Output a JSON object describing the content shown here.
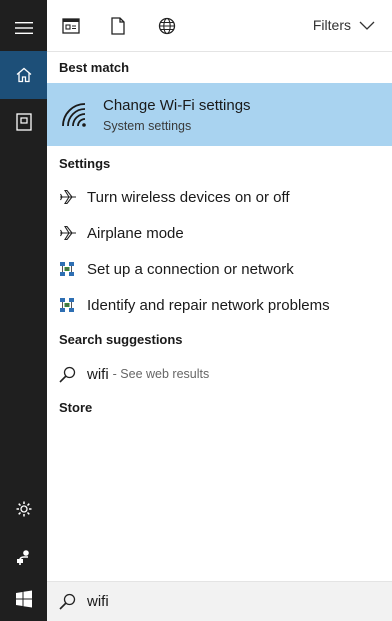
{
  "rail": {
    "menu_icon": "hamburger-menu-icon",
    "home_icon": "home-icon",
    "notebook_icon": "notebook-icon",
    "settings_icon": "gear-icon",
    "feedback_icon": "feedback-icon",
    "start_icon": "windows-start-icon",
    "active_color": "#1d4f78"
  },
  "topbar": {
    "icons": [
      "apps-icon",
      "documents-icon",
      "web-icon"
    ],
    "filters_label": "Filters"
  },
  "best_match": {
    "heading": "Best match",
    "title": "Change Wi-Fi settings",
    "subtitle": "System settings",
    "icon": "wifi-icon",
    "highlight_color": "#a9d3f0"
  },
  "settings": {
    "heading": "Settings",
    "items": [
      {
        "label": "Turn wireless devices on or off",
        "icon": "airplane-icon"
      },
      {
        "label": "Airplane mode",
        "icon": "airplane-icon"
      },
      {
        "label": "Set up a connection or network",
        "icon": "network-icon"
      },
      {
        "label": "Identify and repair network problems",
        "icon": "network-icon"
      }
    ]
  },
  "search_suggestions": {
    "heading": "Search suggestions",
    "query": "wifi",
    "hint": "- See web results"
  },
  "store": {
    "heading": "Store"
  },
  "search": {
    "value": "wifi"
  }
}
